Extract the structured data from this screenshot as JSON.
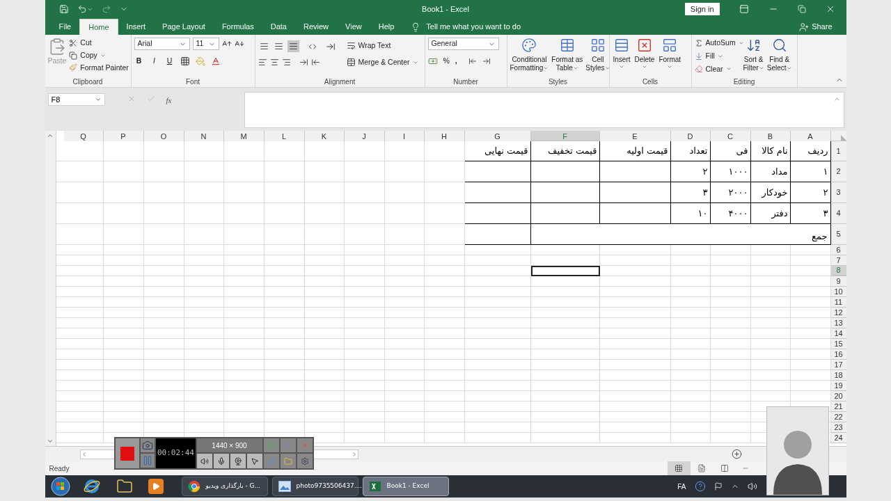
{
  "title_bar": {
    "title": "Book1  -  Excel",
    "sign_in": "Sign in"
  },
  "ribbon_tabs": [
    {
      "label": "File",
      "selected": false
    },
    {
      "label": "Home",
      "selected": true
    },
    {
      "label": "Insert",
      "selected": false
    },
    {
      "label": "Page Layout",
      "selected": false
    },
    {
      "label": "Formulas",
      "selected": false
    },
    {
      "label": "Data",
      "selected": false
    },
    {
      "label": "Review",
      "selected": false
    },
    {
      "label": "View",
      "selected": false
    },
    {
      "label": "Help",
      "selected": false
    }
  ],
  "tell_me": "Tell me what you want to do",
  "share": "Share",
  "clipboard": {
    "group": "Clipboard",
    "paste": "Paste",
    "paste_disabled": true,
    "cut": "Cut",
    "copy": "Copy",
    "format_painter": "Format Painter"
  },
  "font": {
    "group": "Font",
    "name": "Arial",
    "size": "11",
    "bold": "B",
    "italic": "I",
    "underline": "U"
  },
  "alignment": {
    "group": "Alignment",
    "vertical": [
      {
        "selected": false
      },
      {
        "selected": false
      },
      {
        "selected": true
      }
    ],
    "wrap": "Wrap Text",
    "merge": "Merge & Center"
  },
  "number": {
    "group": "Number",
    "format": "General",
    "percent": "%",
    "comma": ","
  },
  "styles": {
    "group": "Styles",
    "buttons": [
      {
        "kind": "conditional",
        "lines": [
          "Conditional",
          "Formatting"
        ]
      },
      {
        "kind": "table",
        "lines": [
          "Format as",
          "Table"
        ]
      },
      {
        "kind": "cell",
        "lines": [
          "Cell",
          "Styles"
        ]
      }
    ]
  },
  "cells": {
    "group": "Cells",
    "buttons": [
      {
        "kind": "insert",
        "label": "Insert"
      },
      {
        "kind": "delete",
        "label": "Delete"
      },
      {
        "kind": "format",
        "label": "Format"
      }
    ]
  },
  "editing": {
    "group": "Editing",
    "autosum": "AutoSum",
    "fill": "Fill",
    "clear": "Clear",
    "sort": [
      "Sort &",
      "Filter"
    ],
    "find": [
      "Find &",
      "Select"
    ]
  },
  "formula_bar": {
    "name_box": "F8",
    "fx": "fx"
  },
  "sheet": {
    "columns": [
      {
        "label": "Q",
        "selected": false
      },
      {
        "label": "P",
        "selected": false
      },
      {
        "label": "O",
        "selected": false
      },
      {
        "label": "N",
        "selected": false
      },
      {
        "label": "M",
        "selected": false
      },
      {
        "label": "L",
        "selected": false
      },
      {
        "label": "K",
        "selected": false
      },
      {
        "label": "J",
        "selected": false
      },
      {
        "label": "I",
        "selected": false
      },
      {
        "label": "H",
        "selected": false
      },
      {
        "label": "G",
        "selected": false
      },
      {
        "label": "F",
        "selected": true
      },
      {
        "label": "E",
        "selected": false
      },
      {
        "label": "D",
        "selected": false
      },
      {
        "label": "C",
        "selected": false
      },
      {
        "label": "B",
        "selected": false
      },
      {
        "label": "A",
        "selected": false
      }
    ],
    "rows": [
      {
        "number": "1",
        "selected": false,
        "cells": [
          "ردیف",
          "نام کالا",
          "فی",
          "تعداد",
          "قیمت اولیه",
          "قیمت تخفیف",
          "قیمت نهایی"
        ]
      },
      {
        "number": "2",
        "selected": false,
        "cells": [
          "۱",
          "مداد",
          "۱۰۰۰",
          "۲"
        ]
      },
      {
        "number": "3",
        "selected": false,
        "cells": [
          "۲",
          "خودکار",
          "۲۰۰۰",
          "۳"
        ]
      },
      {
        "number": "4",
        "selected": false,
        "cells": [
          "۳",
          "دفتر",
          "۴۰۰۰",
          "۱۰"
        ]
      },
      {
        "number": "5",
        "selected": false,
        "merged_label": "جمع"
      },
      {
        "number": "6",
        "selected": false
      },
      {
        "number": "7",
        "selected": false
      },
      {
        "number": "8",
        "selected": true
      },
      {
        "number": "9",
        "selected": false
      },
      {
        "number": "10",
        "selected": false
      },
      {
        "number": "11",
        "selected": false
      },
      {
        "number": "12",
        "selected": false
      },
      {
        "number": "13",
        "selected": false
      },
      {
        "number": "14",
        "selected": false
      },
      {
        "number": "15",
        "selected": false
      },
      {
        "number": "16",
        "selected": false
      },
      {
        "number": "17",
        "selected": false
      },
      {
        "number": "18",
        "selected": false
      },
      {
        "number": "19",
        "selected": false
      },
      {
        "number": "20",
        "selected": false
      },
      {
        "number": "21",
        "selected": false
      },
      {
        "number": "22",
        "selected": false
      },
      {
        "number": "23",
        "selected": false
      },
      {
        "number": "24",
        "selected": false
      }
    ]
  },
  "status": {
    "ready": "Ready",
    "views": [
      {
        "kind": "normal",
        "selected": true
      },
      {
        "kind": "layout",
        "selected": false
      },
      {
        "kind": "break",
        "selected": false
      }
    ]
  },
  "recorder": {
    "timer": "00:02:44",
    "resolution": "1440 × 900"
  },
  "taskbar": {
    "tasks": [
      {
        "kind": "browser",
        "label": "بارگذاری ویدیو - G...",
        "selected": false
      },
      {
        "kind": "photo",
        "label": "photo9735506437....",
        "selected": false
      },
      {
        "kind": "excel",
        "label": "Book1 - Excel",
        "selected": true
      }
    ],
    "language": "FA"
  }
}
